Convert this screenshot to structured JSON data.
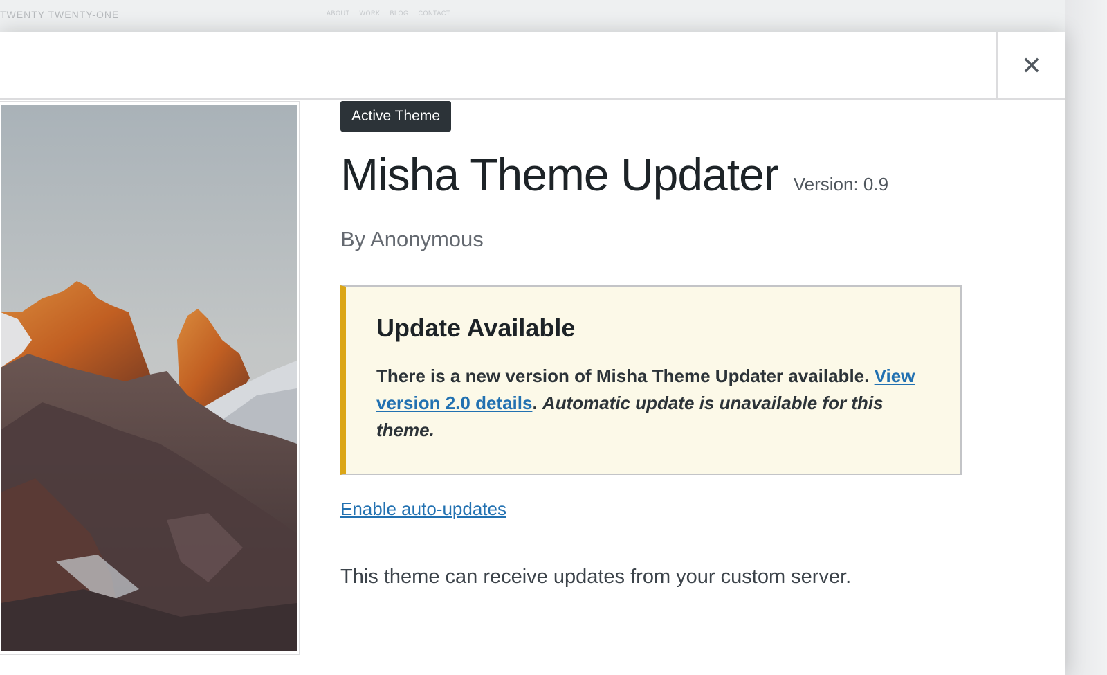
{
  "background": {
    "site_title": "TWENTY TWENTY-ONE",
    "nav": [
      "ABOUT",
      "WORK",
      "BLOG",
      "CONTACT"
    ]
  },
  "header": {
    "close_icon": "close-icon"
  },
  "screenshot": {
    "description_icon": "mountain-landscape-image"
  },
  "theme": {
    "badge": "Active Theme",
    "name": "Misha Theme Updater",
    "version": "Version: 0.9",
    "author": "By Anonymous"
  },
  "notice": {
    "title": "Update Available",
    "text_before": "There is a new version of Misha Theme Updater available.",
    "link_text": "View version 2.0 details",
    "text_after": ".",
    "italic_text": "Automatic update is unavailable for this theme.",
    "accent_color": "#dba617"
  },
  "auto_updates_link": "Enable auto-updates",
  "description": "This theme can receive updates from your custom server.",
  "colors": {
    "link": "#2271b1",
    "badge_bg": "#2c3338",
    "notice_bg": "#fcf9e8"
  }
}
